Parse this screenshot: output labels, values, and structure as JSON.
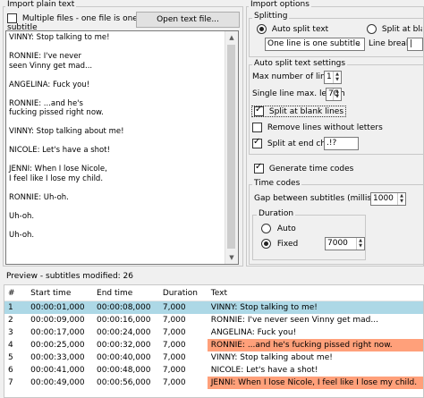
{
  "left_group": {
    "title": "Import plain text",
    "multiple_files_label": "Multiple files - one file is one subtitle",
    "multiple_files_checked": false,
    "open_button": "Open text file...",
    "text_lines": [
      "VINNY: Stop talking to me!",
      "",
      "RONNIE: I've never",
      "seen Vinny get mad...",
      "",
      "ANGELINA: Fuck you!",
      "",
      "RONNIE: ...and he's",
      "fucking pissed right now.",
      "",
      "VINNY: Stop talking about me!",
      "",
      "NICOLE: Let's have a shot!",
      "",
      "JENNI: When I lose Nicole,",
      "I feel like I lose my child.",
      "",
      "RONNIE: Uh-oh.",
      "",
      "Uh-oh.",
      "",
      "Uh-oh."
    ]
  },
  "import_options": {
    "title": "Import options",
    "splitting": {
      "title": "Splitting",
      "auto_split_label": "Auto split text",
      "split_blank_label": "Split at blank li",
      "line_mode_value": "One line is one subtitle",
      "line_break_label": "Line break",
      "line_break_value": "|"
    },
    "auto_split_settings": {
      "title": "Auto split text settings",
      "max_lines_label": "Max number of lines",
      "max_lines_value": "1",
      "single_line_max_label": "Single line max. length",
      "single_line_max_value": "70",
      "split_blank_lines_label": "Split at blank lines",
      "remove_lines_label": "Remove lines without letters",
      "split_end_chars_label": "Split at end chars",
      "end_chars_value": ".!?"
    },
    "generate_time_codes_label": "Generate time codes",
    "time_codes": {
      "title": "Time codes",
      "gap_label": "Gap between subtitles (milliseconds)",
      "gap_value": "1000",
      "duration": {
        "title": "Duration",
        "auto_label": "Auto",
        "fixed_label": "Fixed",
        "fixed_value": "7000"
      }
    }
  },
  "preview": {
    "title": "Preview - subtitles modified: 26",
    "columns": [
      "#",
      "Start time",
      "End time",
      "Duration",
      "Text"
    ],
    "rows": [
      {
        "num": "1",
        "start": "00:00:01,000",
        "end": "00:00:08,000",
        "duration": "7,000",
        "text": "VINNY: Stop talking to me!",
        "state": "selected"
      },
      {
        "num": "2",
        "start": "00:00:09,000",
        "end": "00:00:16,000",
        "duration": "7,000",
        "text": "RONNIE: I've never seen Vinny get mad...",
        "state": "normal"
      },
      {
        "num": "3",
        "start": "00:00:17,000",
        "end": "00:00:24,000",
        "duration": "7,000",
        "text": "ANGELINA: Fuck you!",
        "state": "normal"
      },
      {
        "num": "4",
        "start": "00:00:25,000",
        "end": "00:00:32,000",
        "duration": "7,000",
        "text": "RONNIE: ...and he's fucking pissed right now.",
        "state": "warn"
      },
      {
        "num": "5",
        "start": "00:00:33,000",
        "end": "00:00:40,000",
        "duration": "7,000",
        "text": "VINNY: Stop talking about me!",
        "state": "normal"
      },
      {
        "num": "6",
        "start": "00:00:41,000",
        "end": "00:00:48,000",
        "duration": "7,000",
        "text": "NICOLE: Let's have a shot!",
        "state": "normal"
      },
      {
        "num": "7",
        "start": "00:00:49,000",
        "end": "00:00:56,000",
        "duration": "7,000",
        "text": "JENNI: When I lose Nicole, I feel like I lose my child.",
        "state": "warn"
      }
    ]
  },
  "colors": {
    "selected_row": "#add8e6",
    "warn_cell": "#ffa07a"
  }
}
